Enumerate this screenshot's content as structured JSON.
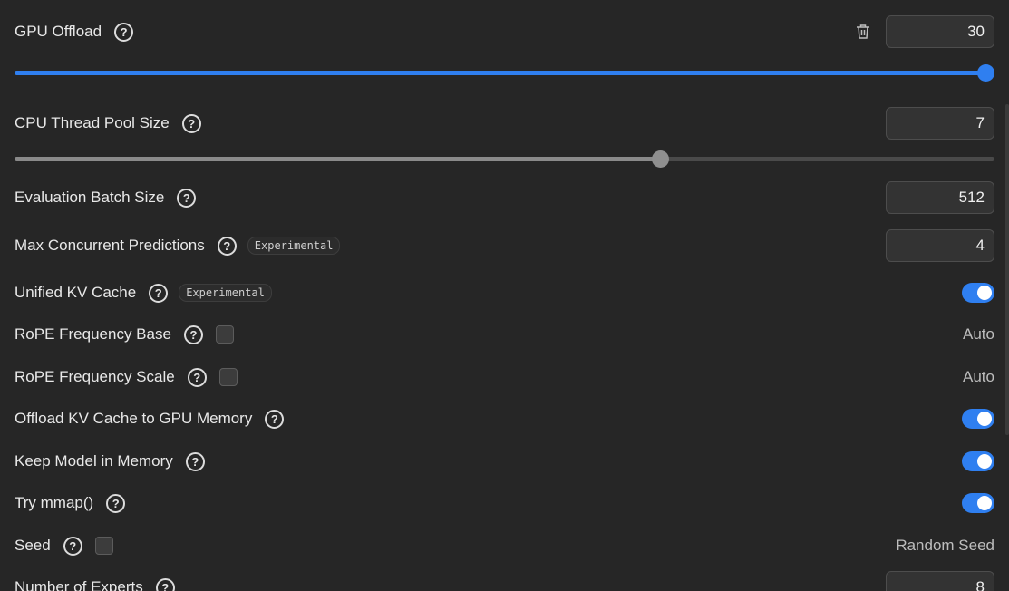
{
  "gpu_offload": {
    "label": "GPU Offload",
    "value": "30",
    "slider_fraction": 1.0
  },
  "cpu_thread_pool": {
    "label": "CPU Thread Pool Size",
    "value": "7",
    "slider_fraction": 0.662
  },
  "eval_batch": {
    "label": "Evaluation Batch Size",
    "value": "512"
  },
  "max_concurrent": {
    "label": "Max Concurrent Predictions",
    "badge": "Experimental",
    "value": "4"
  },
  "unified_kv": {
    "label": "Unified KV Cache",
    "badge": "Experimental",
    "enabled": true
  },
  "rope_base": {
    "label": "RoPE Frequency Base",
    "value": "Auto",
    "checked": false
  },
  "rope_scale": {
    "label": "RoPE Frequency Scale",
    "value": "Auto",
    "checked": false
  },
  "offload_kv": {
    "label": "Offload KV Cache to GPU Memory",
    "enabled": true
  },
  "keep_model": {
    "label": "Keep Model in Memory",
    "enabled": true
  },
  "try_mmap": {
    "label": "Try mmap()",
    "enabled": true
  },
  "seed": {
    "label": "Seed",
    "value": "Random Seed",
    "checked": false
  },
  "num_experts": {
    "label": "Number of Experts",
    "value": "8"
  },
  "help_glyph": "?",
  "colors": {
    "accent": "#2f7ff0",
    "background": "#262626",
    "slider_gray": "#8a8a8a"
  },
  "icons": {
    "help": "question-circle-icon",
    "trash": "trash-icon"
  }
}
